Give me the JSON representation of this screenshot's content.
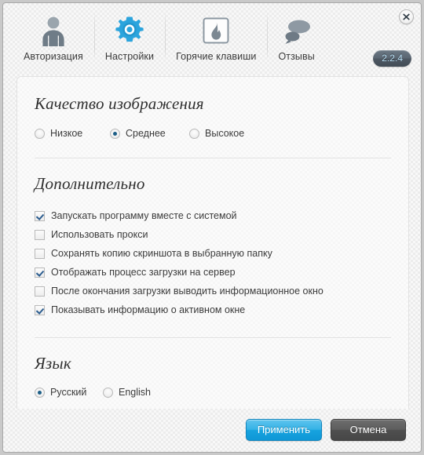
{
  "window": {
    "close_icon": "close-icon",
    "version": "2.2.4"
  },
  "toolbar": {
    "items": [
      {
        "label": "Авторизация",
        "icon": "user-icon",
        "active": false
      },
      {
        "label": "Настройки",
        "icon": "gear-icon",
        "active": true
      },
      {
        "label": "Горячие клавиши",
        "icon": "flame-icon",
        "active": false
      },
      {
        "label": "Отзывы",
        "icon": "speech-bubbles-icon",
        "active": false
      }
    ]
  },
  "sections": {
    "quality": {
      "title": "Качество изображения",
      "options": [
        {
          "label": "Низкое",
          "selected": false
        },
        {
          "label": "Среднее",
          "selected": true
        },
        {
          "label": "Высокое",
          "selected": false
        }
      ]
    },
    "additional": {
      "title": "Дополнительно",
      "checkboxes": [
        {
          "label": "Запускать программу вместе с системой",
          "checked": true
        },
        {
          "label": "Использовать прокси",
          "checked": false
        },
        {
          "label": "Сохранять копию скриншота в выбранную папку",
          "checked": false
        },
        {
          "label": "Отображать процесс загрузки на сервер",
          "checked": true
        },
        {
          "label": "После окончания загрузки выводить информационное окно",
          "checked": false
        },
        {
          "label": "Показывать информацию о активном окне",
          "checked": true
        }
      ]
    },
    "language": {
      "title": "Язык",
      "options": [
        {
          "label": "Русский",
          "selected": true
        },
        {
          "label": "English",
          "selected": false
        }
      ]
    }
  },
  "footer": {
    "apply_label": "Применить",
    "cancel_label": "Отмена"
  },
  "colors": {
    "accent": "#17a3df",
    "radio_dot": "#1d5e86",
    "check_mark": "#2c5d8f",
    "version_text": "#b8dff5"
  }
}
